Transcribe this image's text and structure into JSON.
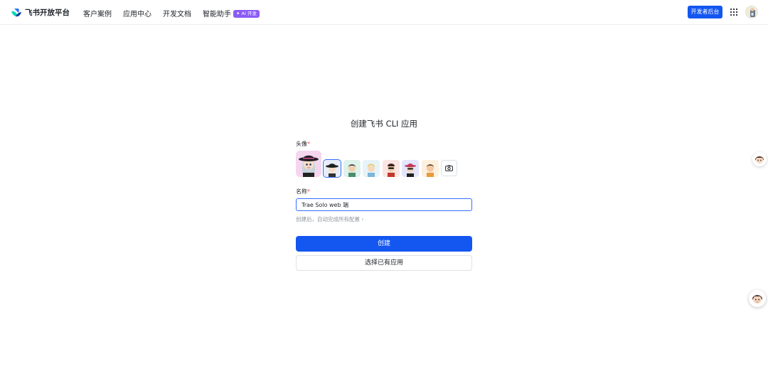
{
  "brand": {
    "name": "飞书开放平台"
  },
  "nav": {
    "items": [
      "客户案例",
      "应用中心",
      "开发文档",
      "智能助手"
    ],
    "ai_badge": "✦ AI 开发"
  },
  "header": {
    "dev_console": "开发者后台"
  },
  "form": {
    "title": "创建飞书 CLI 应用",
    "avatar_label": "头像",
    "name_label": "名称",
    "required_mark": "*",
    "name_value": "Trae Solo web 端",
    "hint": "创建后，自动完成所有配置 ›",
    "create_button": "创建",
    "select_button": "选择已有应用"
  },
  "colors": {
    "primary": "#1456f0",
    "ai_badge": "#8a5cf6",
    "required": "#f54a45",
    "hint": "#8f959e"
  },
  "icons": [
    "feishu-logo-icon",
    "apps-grid-icon",
    "camera-icon"
  ]
}
